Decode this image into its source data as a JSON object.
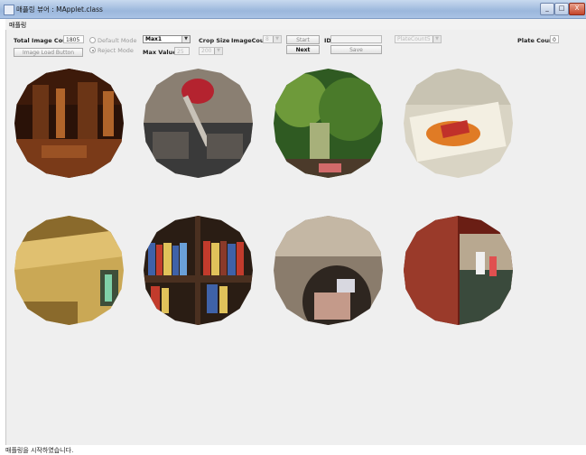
{
  "window": {
    "title": "매플링 뷰어 : MApplet.class",
    "minimize": "_",
    "maximize": "□",
    "close": "X"
  },
  "menu": {
    "items": [
      "매플링"
    ]
  },
  "toolbar": {
    "total_image_count_label": "Total Image Count",
    "total_image_count_value": "1805",
    "image_load_button": "Image Load Button",
    "default_mode": "Default Mode",
    "reject_mode": "Reject Mode",
    "selected_mode": "Reject Mode",
    "max_select_value": "Max1",
    "max_value_label": "Max Value",
    "max_value_value": "25",
    "crop_size_label": "Crop Size",
    "crop_size_value": "200",
    "image_count_label": "ImageCount",
    "image_count_value": "8",
    "start_button": "Start",
    "next_button": "Next",
    "id_label": "ID",
    "id_value": "",
    "save_button": "Save",
    "plate_select_value": "PlateCount5",
    "plate_count_label": "Plate Count",
    "plate_count_value": "0"
  },
  "images": [
    {
      "name": "library-interior-photo",
      "colors": [
        "#2a1208",
        "#6b3516",
        "#b0642a",
        "#3d1a0a"
      ]
    },
    {
      "name": "shoes-and-bag-photo",
      "colors": [
        "#3a3a3a",
        "#8a7f72",
        "#c8c2b8",
        "#b4232f"
      ]
    },
    {
      "name": "garden-doorway-photo",
      "colors": [
        "#2f5a22",
        "#6e9a3a",
        "#a7b07a",
        "#4b3a2a"
      ]
    },
    {
      "name": "snack-bag-photo",
      "colors": [
        "#d9d4c4",
        "#e07b25",
        "#c0312a",
        "#f3efe2"
      ]
    },
    {
      "name": "window-sill-photo",
      "colors": [
        "#8a6a2c",
        "#caa855",
        "#3e4e3a",
        "#7fd0a8"
      ]
    },
    {
      "name": "bookshelf-photo",
      "colors": [
        "#2a1d14",
        "#3f62a8",
        "#c23b2c",
        "#e0c25a"
      ]
    },
    {
      "name": "stone-arch-photo",
      "colors": [
        "#4a3a2e",
        "#8a7c6c",
        "#c4b7a4",
        "#2e2620"
      ]
    },
    {
      "name": "street-door-photo",
      "colors": [
        "#6a1e14",
        "#9a3a2a",
        "#b8a890",
        "#3a4a3c"
      ]
    }
  ],
  "status_bar": {
    "text": "매플링을 시작하였습니다."
  }
}
